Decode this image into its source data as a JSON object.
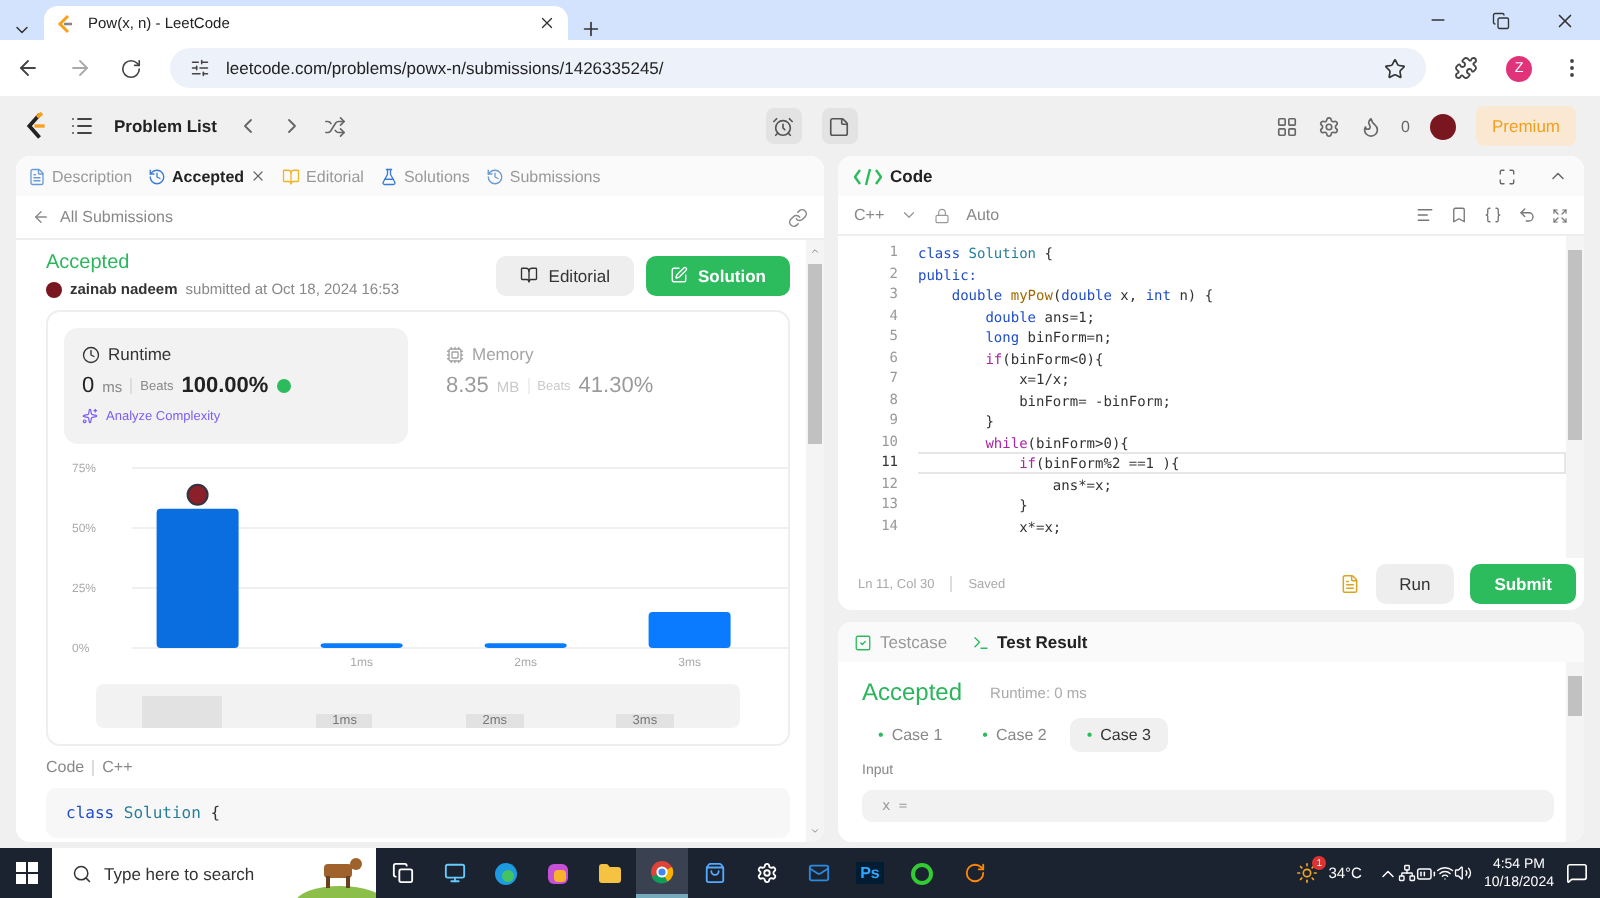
{
  "browser": {
    "tab_title": "Pow(x, n) - LeetCode",
    "url": "leetcode.com/problems/powx-n/submissions/1426335245/",
    "profile": "Z"
  },
  "nav": {
    "problem_list": "Problem List",
    "streak": "0",
    "premium": "Premium"
  },
  "left_tabs": [
    {
      "label": "Description",
      "selected": false,
      "closable": false
    },
    {
      "label": "Accepted",
      "selected": true,
      "closable": true
    },
    {
      "label": "Editorial",
      "selected": false,
      "closable": false
    },
    {
      "label": "Solutions",
      "selected": false,
      "closable": false
    },
    {
      "label": "Submissions",
      "selected": false,
      "closable": false
    }
  ],
  "back_link": "All Submissions",
  "submission": {
    "status": "Accepted",
    "user": "zainab nadeem",
    "submitted": "submitted at Oct 18, 2024 16:53",
    "editorial_button": "Editorial",
    "solution_button": "Solution"
  },
  "stats": [
    {
      "title": "Runtime",
      "value": "0",
      "unit": "ms",
      "beats_label": "Beats",
      "beats": "100.00%",
      "selected": true
    },
    {
      "title": "Memory",
      "value": "8.35",
      "unit": "MB",
      "beats_label": "Beats",
      "beats": "41.30%",
      "selected": false
    }
  ],
  "analyze": "Analyze Complexity",
  "chart_data": {
    "type": "bar",
    "categories": [
      null,
      "1ms",
      "2ms",
      "3ms"
    ],
    "values": [
      58,
      2,
      2,
      15
    ],
    "ylim": [
      0,
      75
    ],
    "yticks": [
      {
        "value": 0,
        "label": "0%"
      },
      {
        "value": 25,
        "label": "25%"
      },
      {
        "value": 50,
        "label": "50%"
      },
      {
        "value": 75,
        "label": "75%"
      }
    ]
  },
  "navigator": {
    "labels": [
      "1ms",
      "2ms",
      "3ms"
    ]
  },
  "code_section": {
    "label": "Code",
    "language": "C++",
    "lines": [
      [
        {
          "kind": "keyword",
          "text": "class"
        },
        {
          "kind": "class",
          "text": " Solution"
        },
        {
          "kind": "plain",
          "text": " {"
        }
      ]
    ]
  },
  "editor": {
    "title": "Code",
    "language": "C++",
    "mode": "Auto",
    "status": "Ln 11, Col 30",
    "saved": "Saved",
    "run": "Run",
    "submit": "Submit",
    "lines": [
      {
        "number": "1",
        "active": false,
        "tokens": [
          {
            "kind": "keyword",
            "text": "class"
          },
          {
            "kind": "class",
            "text": " Solution"
          },
          {
            "kind": "plain",
            "text": " {"
          }
        ]
      },
      {
        "number": "2",
        "active": false,
        "tokens": [
          {
            "kind": "keyword",
            "text": "public:"
          }
        ]
      },
      {
        "number": "3",
        "active": false,
        "tokens": [
          {
            "kind": "keyword",
            "text": "    double"
          },
          {
            "kind": "function",
            "text": " myPow"
          },
          {
            "kind": "plain",
            "text": "("
          },
          {
            "kind": "keyword",
            "text": "double"
          },
          {
            "kind": "plain",
            "text": " x, "
          },
          {
            "kind": "keyword",
            "text": "int"
          },
          {
            "kind": "plain",
            "text": " n) {"
          }
        ]
      },
      {
        "number": "4",
        "active": false,
        "tokens": [
          {
            "kind": "keyword",
            "text": "        double"
          },
          {
            "kind": "plain",
            "text": " ans=1;"
          }
        ]
      },
      {
        "number": "5",
        "active": false,
        "tokens": [
          {
            "kind": "keyword",
            "text": "        long"
          },
          {
            "kind": "plain",
            "text": " binForm=n;"
          }
        ]
      },
      {
        "number": "6",
        "active": false,
        "tokens": [
          {
            "kind": "control",
            "text": "        if"
          },
          {
            "kind": "plain",
            "text": "(binForm<0){"
          }
        ]
      },
      {
        "number": "7",
        "active": false,
        "tokens": [
          {
            "kind": "plain",
            "text": "            x=1/x;"
          }
        ]
      },
      {
        "number": "8",
        "active": false,
        "tokens": [
          {
            "kind": "plain",
            "text": "            binForm= -binForm;"
          }
        ]
      },
      {
        "number": "9",
        "active": false,
        "tokens": [
          {
            "kind": "plain",
            "text": "        }"
          }
        ]
      },
      {
        "number": "10",
        "active": false,
        "tokens": [
          {
            "kind": "control",
            "text": "        while"
          },
          {
            "kind": "plain",
            "text": "(binForm>0){"
          }
        ]
      },
      {
        "number": "11",
        "active": true,
        "tokens": [
          {
            "kind": "control",
            "text": "            if"
          },
          {
            "kind": "plain",
            "text": "(binForm%2 ==1 ){"
          }
        ]
      },
      {
        "number": "12",
        "active": false,
        "tokens": [
          {
            "kind": "plain",
            "text": "                ans*=x;"
          }
        ]
      },
      {
        "number": "13",
        "active": false,
        "tokens": [
          {
            "kind": "plain",
            "text": "            }"
          }
        ]
      },
      {
        "number": "14",
        "active": false,
        "tokens": [
          {
            "kind": "plain",
            "text": "            x*=x;"
          }
        ]
      }
    ]
  },
  "result_tabs": [
    {
      "label": "Testcase",
      "selected": false
    },
    {
      "label": "Test Result",
      "selected": true
    }
  ],
  "result": {
    "status": "Accepted",
    "runtime": "Runtime: 0 ms",
    "input_label": "Input",
    "input_value": "x ="
  },
  "cases": [
    {
      "marker": "•",
      "label": "Case 1",
      "selected": false
    },
    {
      "marker": "•",
      "label": "Case 2",
      "selected": false
    },
    {
      "marker": "•",
      "label": "Case 3",
      "selected": true
    }
  ],
  "taskbar": {
    "search_placeholder": "Type here to search",
    "photoshop": "Ps",
    "weather_badge": "1",
    "temperature": "34°C",
    "time": "4:54 PM",
    "date": "10/18/2024"
  }
}
